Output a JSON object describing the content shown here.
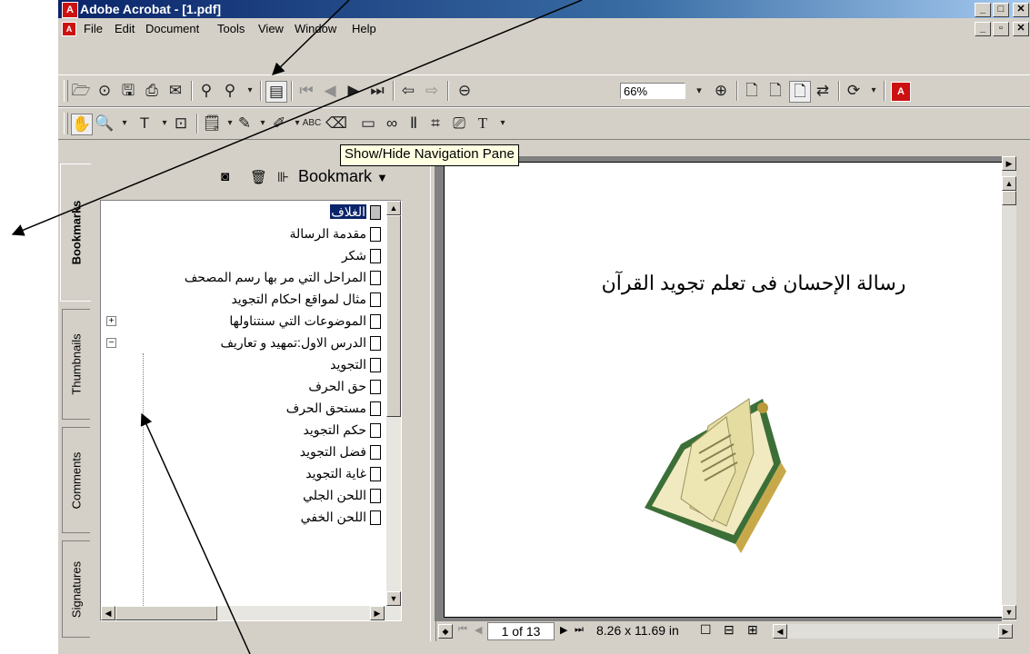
{
  "window": {
    "title": "Adobe Acrobat - [1.pdf]"
  },
  "menubar": {
    "items": [
      "File",
      "Edit",
      "Document",
      "Tools",
      "View",
      "Window",
      "Help"
    ]
  },
  "toolbar": {
    "zoom_value": "66%"
  },
  "tooltip": {
    "text": "Show/Hide Navigation Pane"
  },
  "nav_tabs": [
    "Bookmarks",
    "Thumbnails",
    "Comments",
    "Signatures"
  ],
  "bookmarks_panel": {
    "menu_label": "Bookmark",
    "items": [
      {
        "label": "الغلاف",
        "selected": true,
        "level": 0
      },
      {
        "label": "مقدمة الرسالة",
        "level": 0
      },
      {
        "label": "شكر",
        "level": 0
      },
      {
        "label": "المراحل التي مر بها رسم المصحف",
        "level": 0
      },
      {
        "label": "مثال لمواقع احكام التجويد",
        "level": 0
      },
      {
        "label": "الموضوعات التي سنتناولها",
        "level": 0,
        "expander": "+"
      },
      {
        "label": "الدرس الاول:تمهيد و تعاريف",
        "level": 0,
        "expander": "−"
      },
      {
        "label": "التجويد",
        "level": 1
      },
      {
        "label": "حق الحرف",
        "level": 1
      },
      {
        "label": "مستحق الحرف",
        "level": 1
      },
      {
        "label": "حكم التجويد",
        "level": 1
      },
      {
        "label": "فضل التجويد",
        "level": 1
      },
      {
        "label": "غاية التجويد",
        "level": 1
      },
      {
        "label": "اللحن الجلي",
        "level": 1
      },
      {
        "label": "اللحن الخفي",
        "level": 1
      }
    ]
  },
  "document": {
    "page_title": "رسالة الإحسان فى تعلم تجويد القرآن",
    "page_indicator": "1 of 13",
    "page_size": "8.26 x 11.69 in"
  },
  "colors": {
    "title_bar": "#0a246a",
    "tooltip_bg": "#ffffe1",
    "workspace": "#808080"
  }
}
